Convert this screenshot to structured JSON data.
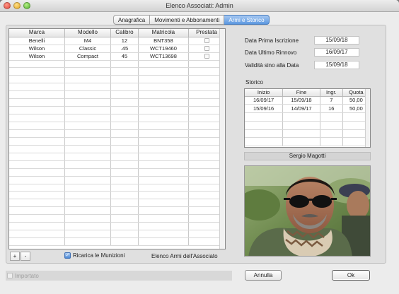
{
  "window": {
    "title": "Elenco Associati: Admin"
  },
  "tabs": [
    {
      "label": "Anagrafica",
      "active": false
    },
    {
      "label": "Movimenti e Abbonamenti",
      "active": false
    },
    {
      "label": "Armi e Storico",
      "active": true
    }
  ],
  "arms_table": {
    "columns": [
      "Marca",
      "Modello",
      "Calibro",
      "Matricola",
      "Prestata"
    ],
    "rows": [
      {
        "marca": "Benelli",
        "modello": "M4",
        "calibro": "12",
        "matricola": "BNT358",
        "prestata": false
      },
      {
        "marca": "Wilson",
        "modello": "Classic",
        "calibro": ".45",
        "matricola": "WCT19460",
        "prestata": false
      },
      {
        "marca": "Wilson",
        "modello": "Compact",
        "calibro": "45",
        "matricola": "WCT13698",
        "prestata": false
      }
    ],
    "add_label": "+",
    "remove_label": "-",
    "reload_label": "Ricarica le Munizioni",
    "reload_checked": true,
    "footer_label": "Elenco Armi dell'Associato"
  },
  "membership": {
    "first_registration_label": "Data Prima Iscrizione",
    "first_registration_value": "15/09/18",
    "last_renewal_label": "Data Ultimo Rinnovo",
    "last_renewal_value": "16/09/17",
    "valid_until_label": "Validità sino alla Data",
    "valid_until_value": "15/09/18"
  },
  "storico": {
    "label": "Storico",
    "columns": [
      "Inizio",
      "Fine",
      "Ingr.",
      "Quota"
    ],
    "rows": [
      {
        "inizio": "16/09/17",
        "fine": "15/09/18",
        "ingr": "7",
        "quota": "50,00"
      },
      {
        "inizio": "15/09/16",
        "fine": "14/09/17",
        "ingr": "16",
        "quota": "50,00"
      }
    ]
  },
  "member": {
    "name": "Sergio  Magotti"
  },
  "footer": {
    "importato_label": "Importato",
    "annulla_label": "Annulla",
    "ok_label": "Ok"
  }
}
